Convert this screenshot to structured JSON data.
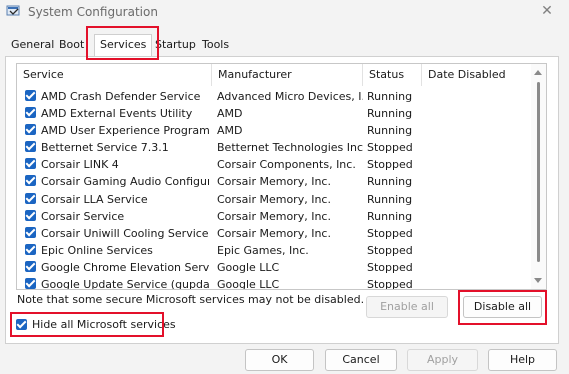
{
  "window": {
    "title": "System Configuration",
    "close_glyph": "✕"
  },
  "tabs": [
    {
      "label": "General"
    },
    {
      "label": "Boot"
    },
    {
      "label": "Services"
    },
    {
      "label": "Startup"
    },
    {
      "label": "Tools"
    }
  ],
  "table": {
    "columns": [
      "Service",
      "Manufacturer",
      "Status",
      "Date Disabled"
    ],
    "rows": [
      {
        "service": "AMD Crash Defender Service",
        "manufacturer": "Advanced Micro Devices, I...",
        "status": "Running"
      },
      {
        "service": "AMD External Events Utility",
        "manufacturer": "AMD",
        "status": "Running"
      },
      {
        "service": "AMD User Experience Program D...",
        "manufacturer": "AMD",
        "status": "Running"
      },
      {
        "service": "Betternet Service 7.3.1",
        "manufacturer": "Betternet Technologies Inc.",
        "status": "Stopped"
      },
      {
        "service": "Corsair LINK 4",
        "manufacturer": "Corsair Components, Inc.",
        "status": "Stopped"
      },
      {
        "service": "Corsair Gaming Audio Configurat...",
        "manufacturer": "Corsair Memory, Inc.",
        "status": "Running"
      },
      {
        "service": "Corsair LLA Service",
        "manufacturer": "Corsair Memory, Inc.",
        "status": "Running"
      },
      {
        "service": "Corsair Service",
        "manufacturer": "Corsair Memory, Inc.",
        "status": "Running"
      },
      {
        "service": "Corsair Uniwill Cooling Service",
        "manufacturer": "Corsair Memory, Inc.",
        "status": "Stopped"
      },
      {
        "service": "Epic Online Services",
        "manufacturer": "Epic Games, Inc.",
        "status": "Stopped"
      },
      {
        "service": "Google Chrome Elevation Servic...",
        "manufacturer": "Google LLC",
        "status": "Stopped"
      },
      {
        "service": "Google Update Service (gupdate)",
        "manufacturer": "Google LLC",
        "status": "Stopped"
      }
    ]
  },
  "note": "Note that some secure Microsoft services may not be disabled.",
  "buttons": {
    "enable_all": "Enable all",
    "disable_all": "Disable all",
    "ok": "OK",
    "cancel": "Cancel",
    "apply": "Apply",
    "help": "Help"
  },
  "hide_ms": {
    "label": "Hide all Microsoft services",
    "checked": true
  },
  "colors": {
    "checkbox": "#1b65c2",
    "highlight": "#e3102a"
  },
  "icons": [
    "msconfig-app-icon",
    "close-icon",
    "checkbox-checked-icon",
    "scroll-up-icon",
    "scroll-down-icon"
  ]
}
